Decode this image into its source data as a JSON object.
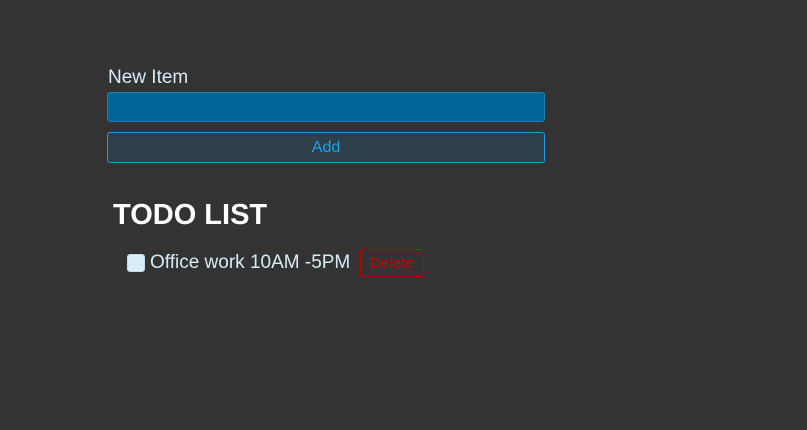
{
  "form": {
    "label": "New Item",
    "input_value": "",
    "input_placeholder": "",
    "add_label": "Add"
  },
  "list": {
    "title": "TODO LIST",
    "items": [
      {
        "text": "Office work 10AM -5PM",
        "checked": false,
        "delete_label": "Delete"
      }
    ]
  },
  "colors": {
    "background": "#333333",
    "input_background": "#006699",
    "accent": "#1aa3ee",
    "danger": "#cc0000"
  }
}
